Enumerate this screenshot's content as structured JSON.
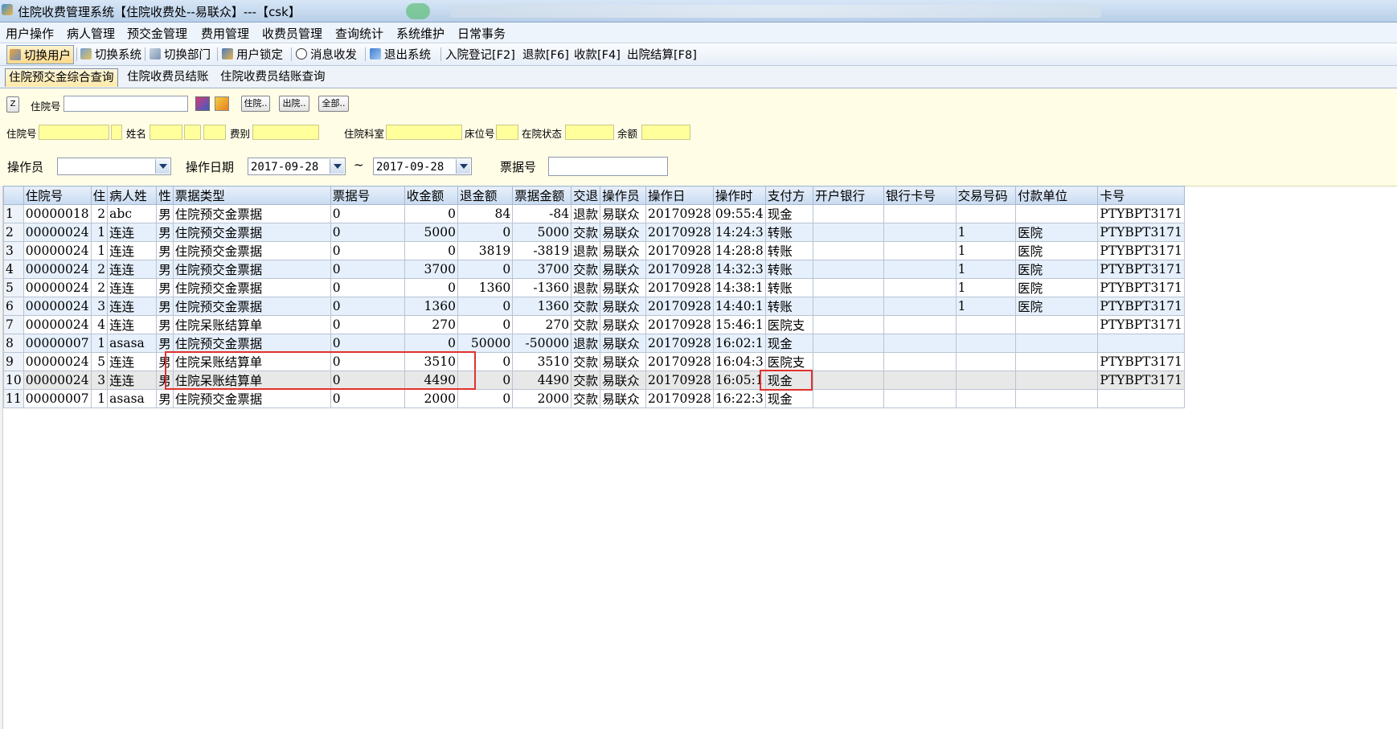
{
  "window": {
    "title": "住院收费管理系统【住院收费处--易联众】---【csk】"
  },
  "menu": [
    "用户操作",
    "病人管理",
    "预交金管理",
    "费用管理",
    "收费员管理",
    "查询统计",
    "系统维护",
    "日常事务"
  ],
  "toolbar": {
    "switch_user": "切换用户",
    "switch_system": "切换系统",
    "switch_dept": "切换部门",
    "user_lock": "用户锁定",
    "messages": "消息收发",
    "exit": "退出系统",
    "admit": "入院登记[F2]",
    "refund": "退款[F6]",
    "collect": "收款[F4]",
    "discharge": "出院结算[F8]"
  },
  "tabs": [
    "住院预交金综合查询",
    "住院收费员结账",
    "住院收费员结账查询"
  ],
  "query": {
    "z_button": "Z",
    "inpatient_no_label": "住院号",
    "inpatient_no_value": "",
    "btn_admit": "住院..",
    "btn_discharge": "出院..",
    "btn_all": "全部..",
    "info_labels": {
      "inpatient_no": "住院号",
      "name": "姓名",
      "fee_type": "费别",
      "dept": "住院科室",
      "bed": "床位号",
      "status": "在院状态",
      "balance": "余额"
    },
    "operator_label": "操作员",
    "operator_value": "",
    "date_label": "操作日期",
    "date_from": "2017-09-28",
    "date_sep": "~",
    "date_to": "2017-09-28",
    "receipt_label": "票据号",
    "receipt_value": ""
  },
  "grid": {
    "headers": [
      "",
      "住院号",
      "住",
      "病人姓",
      "性",
      "票据类型",
      "票据号",
      "收金额",
      "退金额",
      "票据金额",
      "交退",
      "操作员",
      "操作日",
      "操作时",
      "支付方",
      "开户银行",
      "银行卡号",
      "交易号码",
      "付款单位",
      "卡号"
    ],
    "rows": [
      [
        "1",
        "00000018",
        "2",
        "abc",
        "男",
        "住院预交金票据",
        "0",
        "0",
        "84",
        "-84",
        "退款",
        "易联众",
        "20170928",
        "09:55:4",
        "现金",
        "",
        "",
        "",
        "",
        "PTYBPT3171"
      ],
      [
        "2",
        "00000024",
        "1",
        "连连",
        "男",
        "住院预交金票据",
        "0",
        "5000",
        "0",
        "5000",
        "交款",
        "易联众",
        "20170928",
        "14:24:3",
        "转账",
        "",
        "",
        "1",
        "医院",
        "PTYBPT3171"
      ],
      [
        "3",
        "00000024",
        "1",
        "连连",
        "男",
        "住院预交金票据",
        "0",
        "0",
        "3819",
        "-3819",
        "退款",
        "易联众",
        "20170928",
        "14:28:8",
        "转账",
        "",
        "",
        "1",
        "医院",
        "PTYBPT3171"
      ],
      [
        "4",
        "00000024",
        "2",
        "连连",
        "男",
        "住院预交金票据",
        "0",
        "3700",
        "0",
        "3700",
        "交款",
        "易联众",
        "20170928",
        "14:32:3",
        "转账",
        "",
        "",
        "1",
        "医院",
        "PTYBPT3171"
      ],
      [
        "5",
        "00000024",
        "2",
        "连连",
        "男",
        "住院预交金票据",
        "0",
        "0",
        "1360",
        "-1360",
        "退款",
        "易联众",
        "20170928",
        "14:38:1",
        "转账",
        "",
        "",
        "1",
        "医院",
        "PTYBPT3171"
      ],
      [
        "6",
        "00000024",
        "3",
        "连连",
        "男",
        "住院预交金票据",
        "0",
        "1360",
        "0",
        "1360",
        "交款",
        "易联众",
        "20170928",
        "14:40:1",
        "转账",
        "",
        "",
        "1",
        "医院",
        "PTYBPT3171"
      ],
      [
        "7",
        "00000024",
        "4",
        "连连",
        "男",
        "住院呆账结算单",
        "0",
        "270",
        "0",
        "270",
        "交款",
        "易联众",
        "20170928",
        "15:46:1",
        "医院支",
        "",
        "",
        "",
        "",
        "PTYBPT3171"
      ],
      [
        "8",
        "00000007",
        "1",
        "asasa",
        "男",
        "住院预交金票据",
        "0",
        "0",
        "50000",
        "-50000",
        "退款",
        "易联众",
        "20170928",
        "16:02:1",
        "现金",
        "",
        "",
        "",
        "",
        ""
      ],
      [
        "9",
        "00000024",
        "5",
        "连连",
        "男",
        "住院呆账结算单",
        "0",
        "3510",
        "0",
        "3510",
        "交款",
        "易联众",
        "20170928",
        "16:04:3",
        "医院支",
        "",
        "",
        "",
        "",
        "PTYBPT3171"
      ],
      [
        "10",
        "00000024",
        "3",
        "连连",
        "男",
        "住院呆账结算单",
        "0",
        "4490",
        "0",
        "4490",
        "交款",
        "易联众",
        "20170928",
        "16:05:1",
        "现金",
        "",
        "",
        "",
        "",
        "PTYBPT3171"
      ],
      [
        "11",
        "00000007",
        "1",
        "asasa",
        "男",
        "住院预交金票据",
        "0",
        "2000",
        "0",
        "2000",
        "交款",
        "易联众",
        "20170928",
        "16:22:3",
        "现金",
        "",
        "",
        "",
        "",
        ""
      ]
    ]
  },
  "colors": {
    "highlight": "#e0322e",
    "query_bg": "#fffde6",
    "field_yellow": "#ffff9c"
  }
}
